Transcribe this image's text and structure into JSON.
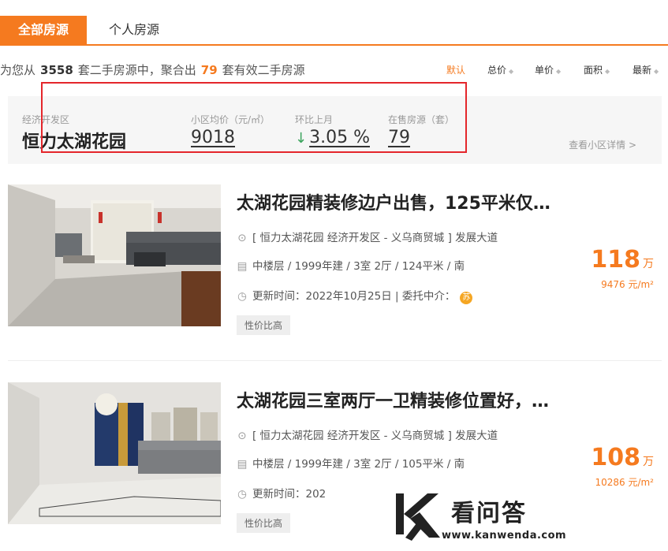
{
  "tabs": [
    {
      "label": "全部房源",
      "active": true
    },
    {
      "label": "个人房源",
      "active": false
    }
  ],
  "summary": {
    "prefix": "为您从",
    "total": "3558",
    "middle": "套二手房源中，聚合出",
    "matched": "79",
    "suffix": "套有效二手房源"
  },
  "sort_options": [
    {
      "label": "默认",
      "active": true
    },
    {
      "label": "总价"
    },
    {
      "label": "单价"
    },
    {
      "label": "面积"
    },
    {
      "label": "最新"
    }
  ],
  "community": {
    "district": "经济开发区",
    "name": "恒力太湖花园",
    "avg_price_label": "小区均价（元/㎡）",
    "avg_price": "9018",
    "mom_label": "环比上月",
    "mom_value": "3.05 %",
    "on_sale_label": "在售房源（套）",
    "on_sale": "79",
    "detail_link": "查看小区详情 >"
  },
  "listings": [
    {
      "title": "太湖花园精装修边户出售，125平米仅…",
      "address": "[ 恒力太湖花园 经济开发区 - 义乌商贸城 ] 发展大道",
      "layout": "中楼层 / 1999年建 / 3室 2厅 / 124平米 / 南",
      "update": "更新时间：2022年10月25日 | 委托中介：",
      "agent_badge": "苏",
      "tag": "性价比高",
      "price": "118",
      "price_unit": "万",
      "unit_price": "9476 元/m²"
    },
    {
      "title": "太湖花园三室两厅一卫精装修位置好，…",
      "address": "[ 恒力太湖花园 经济开发区 - 义乌商贸城 ] 发展大道",
      "layout": "中楼层 / 1999年建 / 3室 2厅 / 105平米 / 南",
      "update": "更新时间：202",
      "tag": "性价比高",
      "price": "108",
      "price_unit": "万",
      "unit_price": "10286 元/m²"
    }
  ],
  "watermark": {
    "text": "看问答",
    "url": "www.kanwenda.com"
  },
  "colors": {
    "accent": "#f57a1f",
    "highlight_box": "#e4262b",
    "down_arrow": "#3aa35c"
  }
}
